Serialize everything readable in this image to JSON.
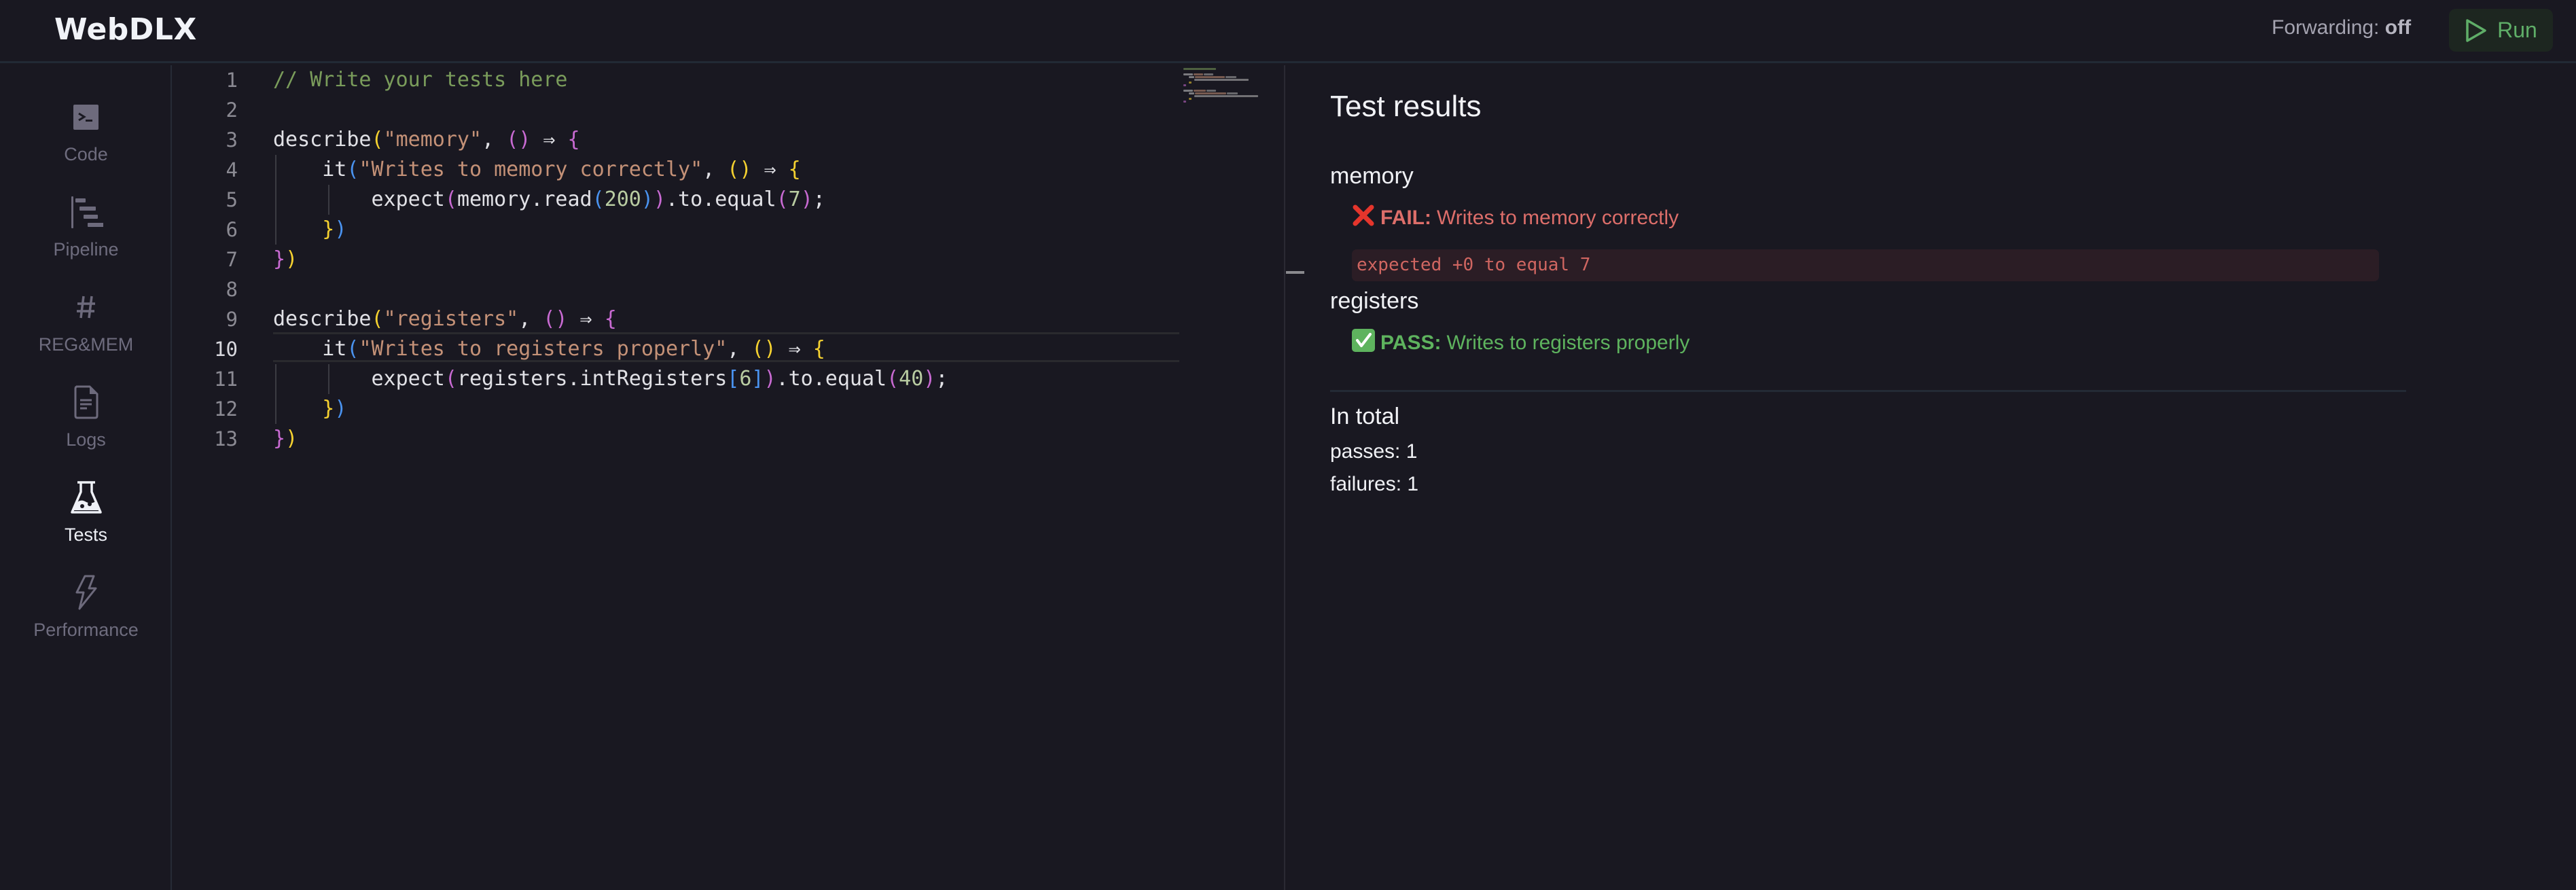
{
  "header": {
    "app_title": "WebDLX",
    "forwarding_label": "Forwarding:",
    "forwarding_value": "off",
    "run_label": "Run"
  },
  "sidebar": {
    "items": [
      {
        "label": "Code",
        "icon": "terminal-icon",
        "active": false
      },
      {
        "label": "Pipeline",
        "icon": "pipeline-icon",
        "active": false
      },
      {
        "label": "REG&MEM",
        "icon": "hash-icon",
        "active": false
      },
      {
        "label": "Logs",
        "icon": "document-icon",
        "active": false
      },
      {
        "label": "Tests",
        "icon": "flask-icon",
        "active": true
      },
      {
        "label": "Performance",
        "icon": "lightning-icon",
        "active": false
      }
    ]
  },
  "editor": {
    "current_line": 10,
    "lines": [
      "// Write your tests here",
      "",
      "describe(\"memory\", () ⇒ {",
      "    it(\"Writes to memory correctly\", () ⇒ {",
      "        expect(memory.read(200)).to.equal(7);",
      "    })",
      "})",
      "",
      "describe(\"registers\", () ⇒ {",
      "    it(\"Writes to registers properly\", () ⇒ {",
      "        expect(registers.intRegisters[6]).to.equal(40);",
      "    })",
      "})"
    ]
  },
  "results": {
    "title": "Test results",
    "suites": [
      {
        "name": "memory",
        "tests": [
          {
            "status": "FAIL",
            "status_label": "FAIL:",
            "name": "Writes to memory correctly",
            "icon": "cross-mark-icon",
            "error": "expected +0 to equal 7"
          }
        ]
      },
      {
        "name": "registers",
        "tests": [
          {
            "status": "PASS",
            "status_label": "PASS:",
            "name": "Writes to registers properly",
            "icon": "check-mark-icon"
          }
        ]
      }
    ],
    "total": {
      "heading": "In total",
      "passes_label": "passes:",
      "passes": 1,
      "failures_label": "failures:",
      "failures": 1
    }
  },
  "colors": {
    "background": "#191821",
    "fail": "#dd6e6a",
    "pass": "#5eb35e",
    "run_accent": "#5fae68"
  }
}
